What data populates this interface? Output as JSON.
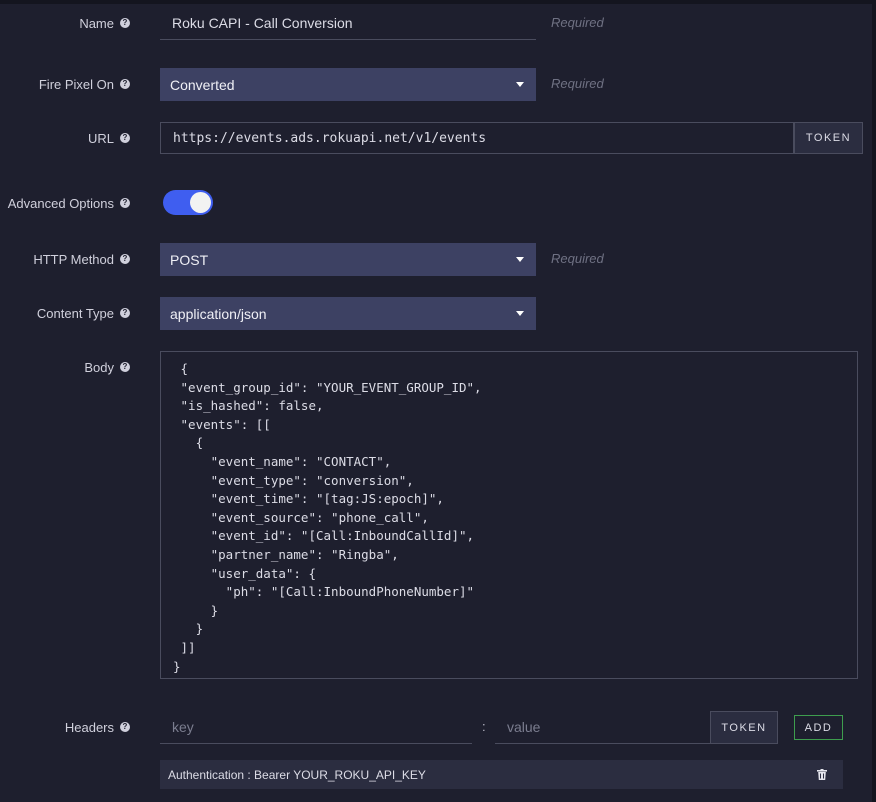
{
  "form": {
    "name": {
      "label": "Name",
      "value": "Roku CAPI - Call Conversion",
      "hint": "Required"
    },
    "fire_pixel_on": {
      "label": "Fire Pixel On",
      "selected": "Converted",
      "hint": "Required"
    },
    "url": {
      "label": "URL",
      "value": "https://events.ads.rokuapi.net/v1/events",
      "token_label": "TOKEN"
    },
    "advanced_options": {
      "label": "Advanced Options",
      "enabled": true
    },
    "http_method": {
      "label": "HTTP Method",
      "selected": "POST",
      "hint": "Required"
    },
    "content_type": {
      "label": "Content Type",
      "selected": "application/json"
    },
    "body": {
      "label": "Body",
      "value": " {\n \"event_group_id\": \"YOUR_EVENT_GROUP_ID\",\n \"is_hashed\": false,\n \"events\": [[\n   {\n     \"event_name\": \"CONTACT\",\n     \"event_type\": \"conversion\",\n     \"event_time\": \"[tag:JS:epoch]\",\n     \"event_source\": \"phone_call\",\n     \"event_id\": \"[Call:InboundCallId]\",\n     \"partner_name\": \"Ringba\",\n     \"user_data\": {\n       \"ph\": \"[Call:InboundPhoneNumber]\"\n     }\n   }\n ]]\n}"
    },
    "headers": {
      "label": "Headers",
      "key_placeholder": "key",
      "separator": ":",
      "value_placeholder": "value",
      "token_label": "TOKEN",
      "add_label": "ADD",
      "items": [
        {
          "text": "Authentication : Bearer YOUR_ROKU_API_KEY"
        }
      ]
    }
  },
  "icons": {
    "help": "question-circle-icon",
    "caret": "caret-down-icon",
    "delete": "trash-icon"
  },
  "colors": {
    "background": "#1e1f2e",
    "select": "#3d4163",
    "toggle": "#3f5ef0",
    "add_border": "#3e9d4e"
  }
}
